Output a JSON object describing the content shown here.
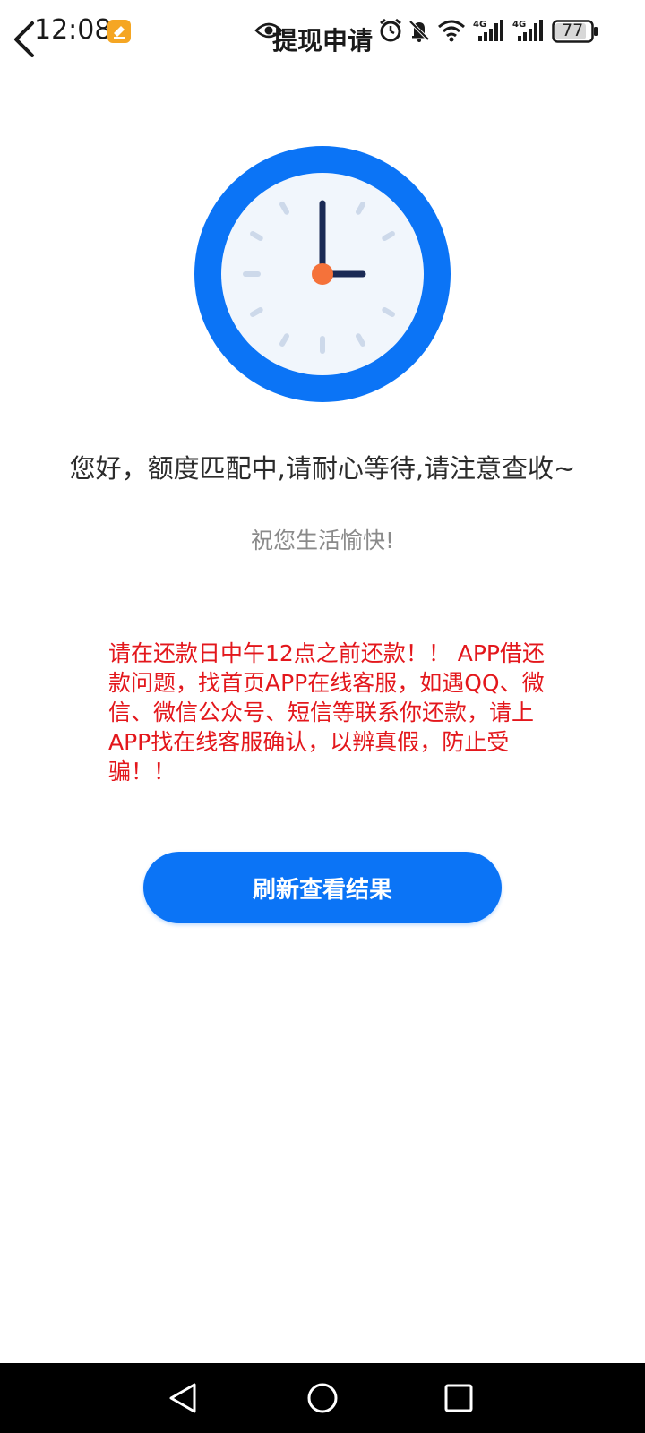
{
  "status_bar": {
    "time": "12:08",
    "battery_level": "77",
    "icons": [
      "eye-icon",
      "alarm-icon",
      "mute-bell-icon",
      "wifi-icon",
      "signal-4g-icon",
      "signal-4g-icon",
      "battery-icon"
    ]
  },
  "header": {
    "title": "提现申请",
    "back_icon": "chevron-left-icon"
  },
  "clock": {
    "hour": 3,
    "minute": 0,
    "ring_color": "#0b74f6",
    "face_color": "#f1f6fc",
    "hand_color": "#1a2a55",
    "center_color": "#f5723a"
  },
  "main": {
    "greeting": "您好，额度匹配中,请耐心等待,请注意查收~",
    "wish": "祝您生活愉快!",
    "warning": "请在还款日中午12点之前还款！！ APP借还款问题，找首页APP在线客服，如遇QQ、微信、微信公众号、短信等联系你还款，请上APP找在线客服确认，以辨真假，防止受骗！！",
    "refresh_label": "刷新查看结果"
  },
  "nav": {
    "icons": [
      "back-triangle-icon",
      "home-circle-icon",
      "recents-square-icon"
    ]
  },
  "colors": {
    "accent": "#0b74f6",
    "warning": "#e3171c"
  }
}
